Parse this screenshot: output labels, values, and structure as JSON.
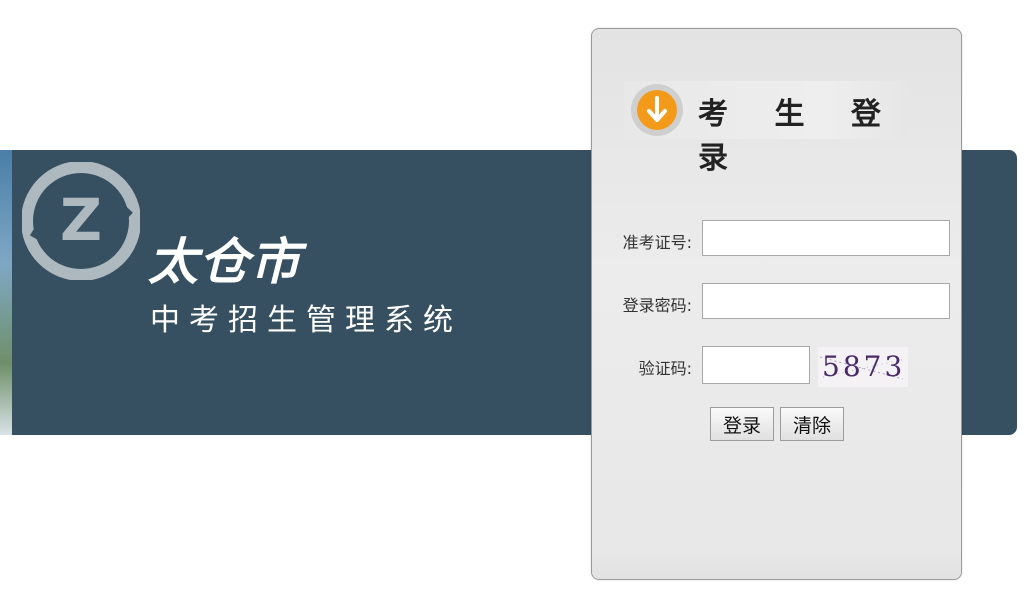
{
  "banner": {
    "logo_letter": "Z",
    "city_name": "太仓市",
    "system_name": "中考招生管理系统"
  },
  "login": {
    "title": "考 生 登 录",
    "fields": {
      "exam_id": {
        "label": "准考证号:",
        "value": ""
      },
      "password": {
        "label": "登录密码:",
        "value": ""
      },
      "captcha": {
        "label": "验证码:",
        "value": ""
      }
    },
    "captcha_image_text": "5873",
    "buttons": {
      "login": "登录",
      "clear": "清除"
    }
  },
  "colors": {
    "banner_bg": "#365062",
    "panel_bg": "#e8e8e8",
    "icon_orange": "#f39a1a"
  }
}
